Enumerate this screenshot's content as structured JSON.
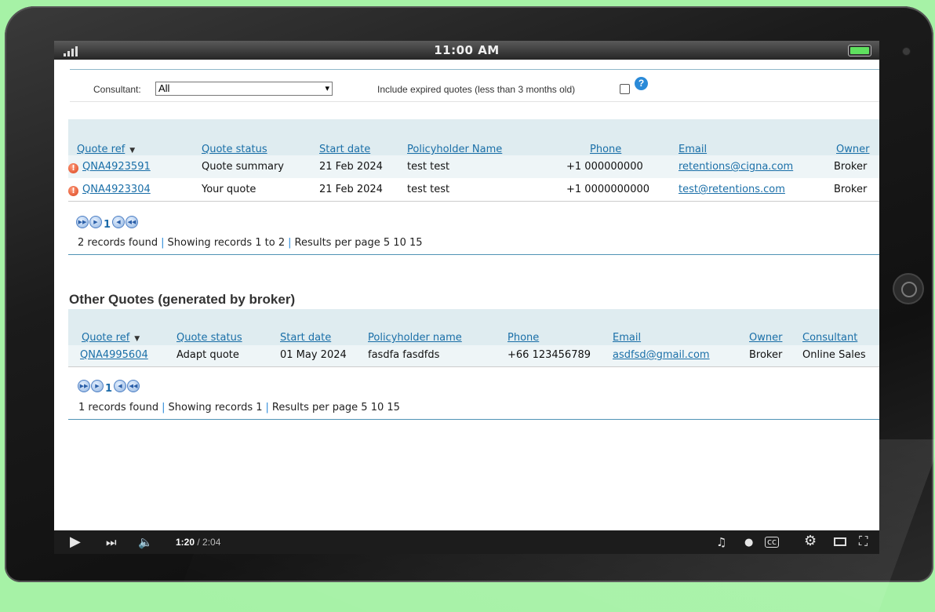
{
  "status_bar": {
    "time": "11:00 AM"
  },
  "filters": {
    "consultant_label": "Consultant:",
    "consultant_value": "All",
    "expired_label": "Include expired quotes (less than 3 months old)",
    "help_glyph": "?"
  },
  "my_quotes": {
    "columns": [
      "Quote ref",
      "Quote status",
      "Start date",
      "Policyholder Name",
      "Phone",
      "Email",
      "Owner"
    ],
    "rows": [
      {
        "ref": "QNA4923591",
        "status": "Quote summary",
        "start": "21 Feb 2024",
        "name": "test test",
        "phone": "+1 000000000",
        "email": "retentions@cigna.com",
        "owner": "Broker"
      },
      {
        "ref": "QNA4923304",
        "status": "Your quote",
        "start": "21 Feb 2024",
        "name": "test test",
        "phone": "+1 0000000000",
        "email": "test@retentions.com",
        "owner": "Broker"
      }
    ],
    "pager_page": "1",
    "records_found": "2 records found",
    "showing": "Showing records 1 to 2",
    "per_page": "Results per page 5 10 15"
  },
  "other_quotes": {
    "title": "Other Quotes (generated by broker)",
    "columns": [
      "Quote ref",
      "Quote status",
      "Start date",
      "Policyholder name",
      "Phone",
      "Email",
      "Owner",
      "Consultant"
    ],
    "rows": [
      {
        "ref": "QNA4995604",
        "status": "Adapt quote",
        "start": "01 May 2024",
        "name": "fasdfa fasdfds",
        "phone": "+66 123456789",
        "email": "asdfsd@gmail.com",
        "owner": "Broker",
        "consultant": "Online Sales"
      }
    ],
    "pager_page": "1",
    "records_found": "1 records found",
    "showing": "Showing records 1",
    "per_page": "Results per page 5 10 15"
  },
  "video": {
    "current": "1:20",
    "total": "/ 2:04"
  }
}
